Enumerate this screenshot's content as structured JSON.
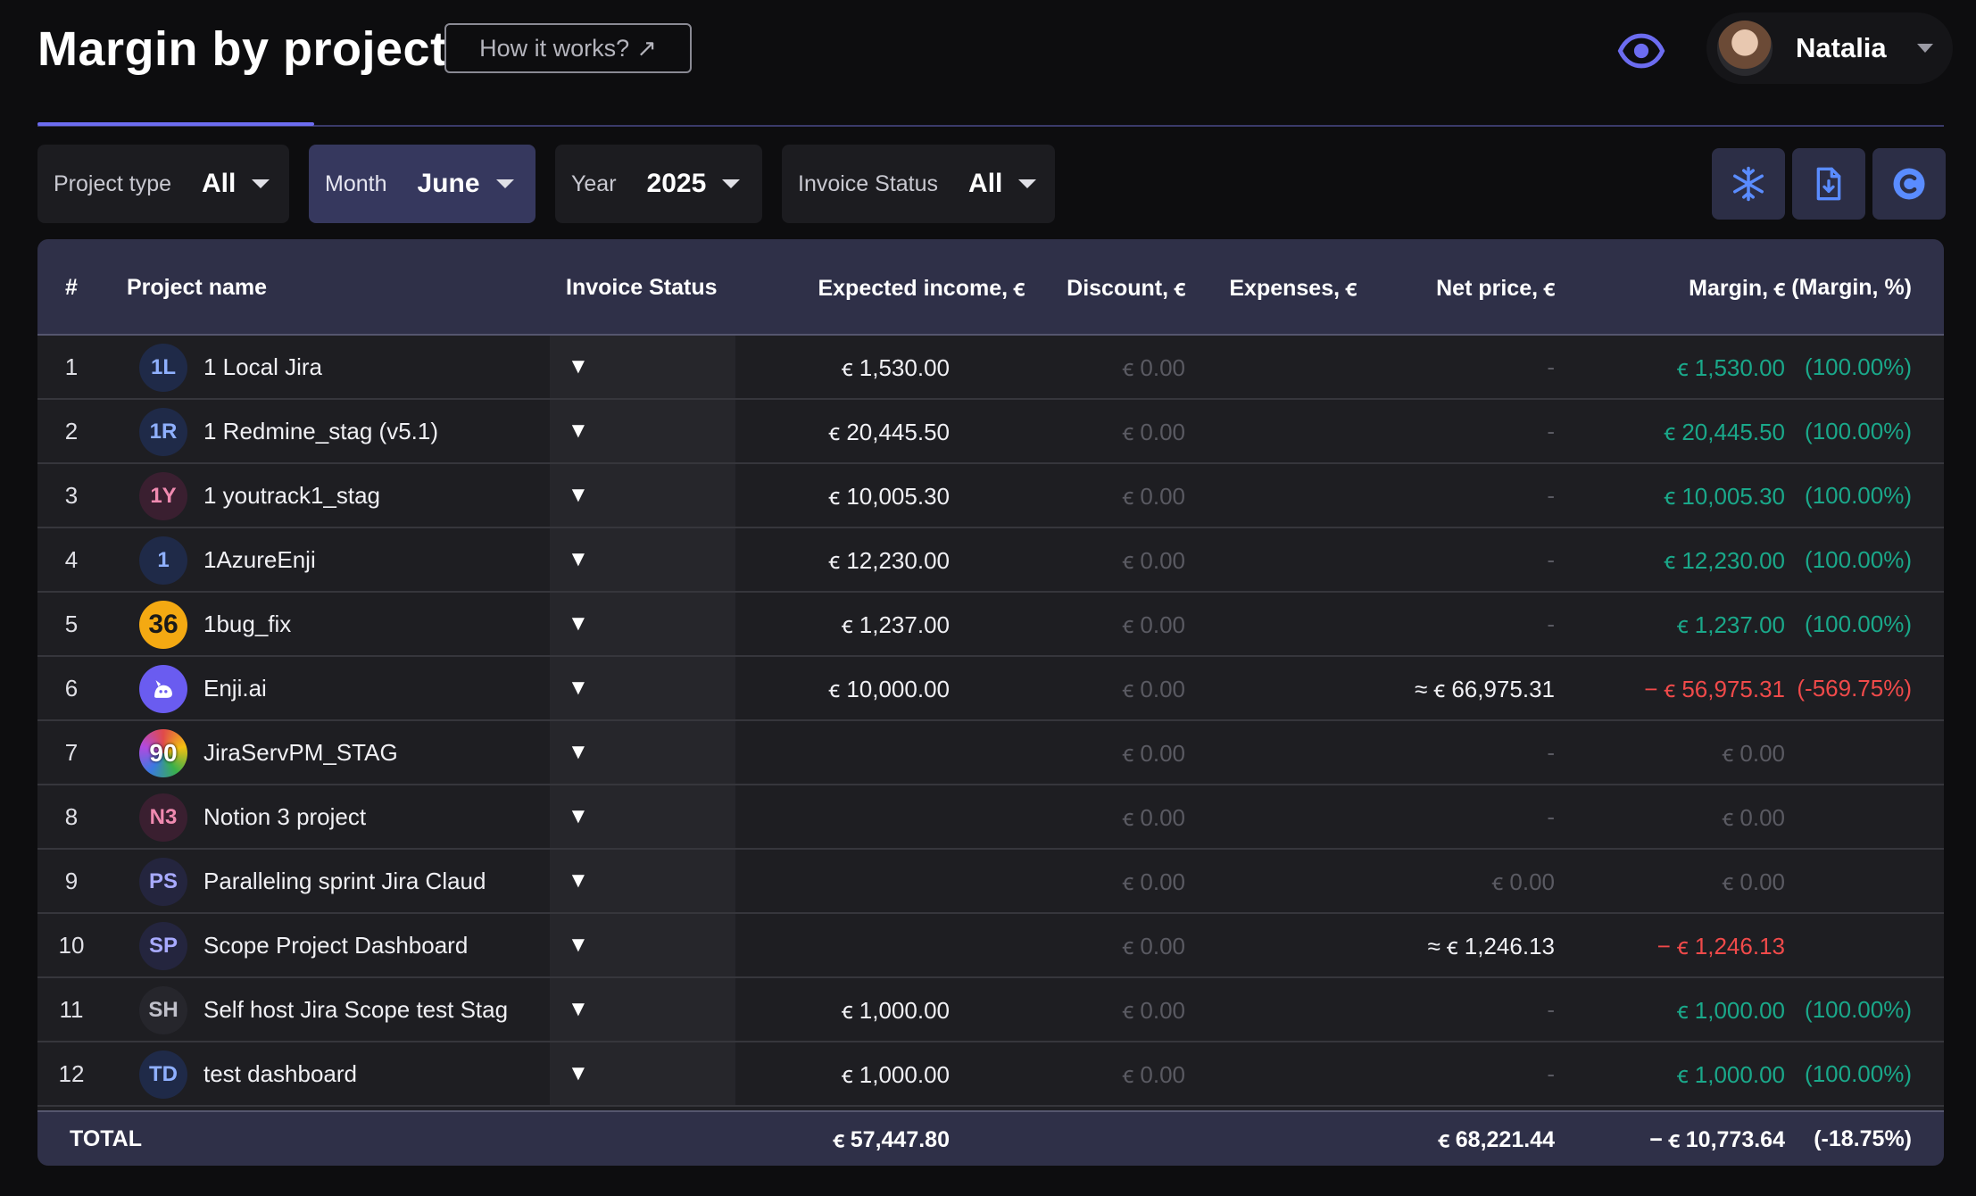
{
  "header": {
    "title": "Margin by project",
    "how_it_works": "How it works?",
    "how_it_works_icon": "↗",
    "user_name": "Natalia"
  },
  "filters": [
    {
      "label": "Project type",
      "value": "All"
    },
    {
      "label": "Month",
      "value": "June"
    },
    {
      "label": "Year",
      "value": "2025"
    },
    {
      "label": "Invoice Status",
      "value": "All"
    }
  ],
  "columns": {
    "num": "#",
    "project": "Project name",
    "invoice_status": "Invoice Status",
    "expected": "Expected income, ꞓ",
    "discount": "Discount, ꞓ",
    "expenses": "Expenses, ꞓ",
    "net_price": "Net price, ꞓ",
    "margin": "Margin, ꞓ",
    "margin_pct": "(Margin, %)"
  },
  "rows": [
    {
      "num": "1",
      "icon": "1L",
      "name": "1 Local Jira",
      "status": "▼",
      "expected": "ꞓ 1,530.00",
      "discount": "ꞓ 0.00",
      "net": "-",
      "margin": "ꞓ 1,530.00",
      "pct": "(100.00%)"
    },
    {
      "num": "2",
      "icon": "1R",
      "name": "1 Redmine_stag (v5.1)",
      "status": "▼",
      "expected": "ꞓ 20,445.50",
      "discount": "ꞓ 0.00",
      "net": "-",
      "margin": "ꞓ 20,445.50",
      "pct": "(100.00%)"
    },
    {
      "num": "3",
      "icon": "1Y",
      "name": "1 youtrack1_stag",
      "status": "▼",
      "expected": "ꞓ 10,005.30",
      "discount": "ꞓ 0.00",
      "net": "-",
      "margin": "ꞓ 10,005.30",
      "pct": "(100.00%)"
    },
    {
      "num": "4",
      "icon": "1",
      "name": "1AzureEnji",
      "status": "▼",
      "expected": "ꞓ 12,230.00",
      "discount": "ꞓ 0.00",
      "net": "-",
      "margin": "ꞓ 12,230.00",
      "pct": "(100.00%)"
    },
    {
      "num": "5",
      "icon": "36",
      "name": "1bug_fix",
      "status": "▼",
      "expected": "ꞓ 1,237.00",
      "discount": "ꞓ 0.00",
      "net": "-",
      "margin": "ꞓ 1,237.00",
      "pct": "(100.00%)"
    },
    {
      "num": "6",
      "icon": "",
      "name": "Enji.ai",
      "status": "▼",
      "expected": "ꞓ 10,000.00",
      "discount": "ꞓ 0.00",
      "net": "≈ ꞓ 66,975.31",
      "margin": "− ꞓ 56,975.31",
      "pct": "(-569.75%)"
    },
    {
      "num": "7",
      "icon": "90",
      "name": "JiraServPM_STAG",
      "status": "▼",
      "expected": "",
      "discount": "ꞓ 0.00",
      "net": "-",
      "margin": "ꞓ 0.00",
      "pct": ""
    },
    {
      "num": "8",
      "icon": "N3",
      "name": "Notion 3 project",
      "status": "▼",
      "expected": "",
      "discount": "ꞓ 0.00",
      "net": "-",
      "margin": "ꞓ 0.00",
      "pct": ""
    },
    {
      "num": "9",
      "icon": "PS",
      "name": "Paralleling sprint Jira Claud",
      "status": "▼",
      "expected": "",
      "discount": "ꞓ 0.00",
      "net": "ꞓ 0.00",
      "margin": "ꞓ 0.00",
      "pct": ""
    },
    {
      "num": "10",
      "icon": "SP",
      "name": "Scope Project Dashboard",
      "status": "▼",
      "expected": "",
      "discount": "ꞓ 0.00",
      "net": "≈ ꞓ 1,246.13",
      "margin": "− ꞓ 1,246.13",
      "pct": ""
    },
    {
      "num": "11",
      "icon": "SH",
      "name": "Self host Jira Scope test Stag",
      "status": "▼",
      "expected": "ꞓ 1,000.00",
      "discount": "ꞓ 0.00",
      "net": "-",
      "margin": "ꞓ 1,000.00",
      "pct": "(100.00%)"
    },
    {
      "num": "12",
      "icon": "TD",
      "name": "test dashboard",
      "status": "▼",
      "expected": "ꞓ 1,000.00",
      "discount": "ꞓ 0.00",
      "net": "-",
      "margin": "ꞓ 1,000.00",
      "pct": "(100.00%)"
    }
  ],
  "total": {
    "label": "TOTAL",
    "expected": "ꞓ 57,447.80",
    "net": "ꞓ 68,221.44",
    "margin": "− ꞓ 10,773.64",
    "pct": "(-18.75%)"
  },
  "colors": {
    "positive": "#1aa88a",
    "negative": "#f04a4a",
    "accent": "#6c6cf0"
  }
}
